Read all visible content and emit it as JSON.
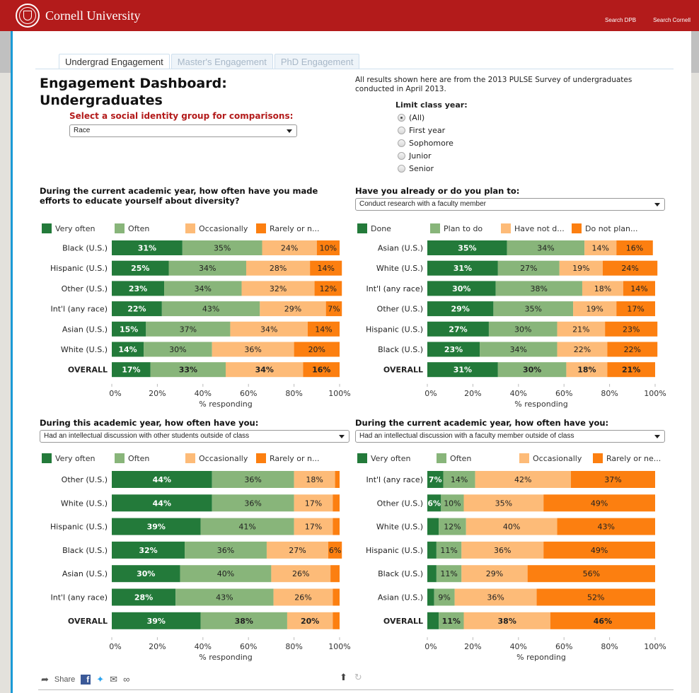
{
  "header": {
    "brand": "Cornell University",
    "links": [
      "Search DPB",
      "Search Cornell"
    ]
  },
  "tabs": [
    {
      "label": "Undergrad Engagement",
      "active": true
    },
    {
      "label": "Master's Engagement",
      "active": false
    },
    {
      "label": "PhD Engagement",
      "active": false
    }
  ],
  "page": {
    "title_line1": "Engagement Dashboard:",
    "title_line2": "Undergraduates",
    "intro": "All results shown here are from the 2013 PULSE Survey of undergraduates conducted in April 2013."
  },
  "group_select": {
    "label": "Select a social identity group for comparisons:",
    "value": "Race"
  },
  "class_year": {
    "label": "Limit class year:",
    "options": [
      "(All)",
      "First year",
      "Sophomore",
      "Junior",
      "Senior"
    ],
    "selected": "(All)"
  },
  "colors": {
    "dark_green": "#237a3a",
    "light_green": "#88b57a",
    "light_orange": "#fdbb78",
    "orange": "#fc7f10"
  },
  "chart_data": [
    {
      "type": "bar",
      "stacked": true,
      "orientation": "horizontal",
      "title": "During the current academic year, how often have you made efforts to educate yourself about diversity?",
      "dropdown": null,
      "legend": [
        "Very often",
        "Often",
        "Occasionally",
        "Rarely or n..."
      ],
      "categories": [
        "Black (U.S.)",
        "Hispanic (U.S.)",
        "Other (U.S.)",
        "Int'l (any race)",
        "Asian (U.S.)",
        "White (U.S.)",
        "OVERALL"
      ],
      "series": [
        {
          "name": "Very often",
          "values": [
            31,
            25,
            23,
            22,
            15,
            14,
            17
          ]
        },
        {
          "name": "Often",
          "values": [
            35,
            34,
            34,
            43,
            37,
            30,
            33
          ]
        },
        {
          "name": "Occasionally",
          "values": [
            24,
            28,
            32,
            29,
            34,
            36,
            34
          ]
        },
        {
          "name": "Rarely or never",
          "values": [
            10,
            14,
            12,
            7,
            14,
            20,
            16
          ]
        }
      ],
      "xlabel": "% responding",
      "xticks": [
        "0%",
        "20%",
        "40%",
        "60%",
        "80%",
        "100%"
      ],
      "xlim": [
        0,
        100
      ]
    },
    {
      "type": "bar",
      "stacked": true,
      "orientation": "horizontal",
      "title": "Have you already or do you plan to:",
      "dropdown": "Conduct research with a faculty member",
      "legend": [
        "Done",
        "Plan to do",
        "Have not d...",
        "Do not plan..."
      ],
      "categories": [
        "Asian (U.S.)",
        "White (U.S.)",
        "Int'l (any race)",
        "Other (U.S.)",
        "Hispanic (U.S.)",
        "Black (U.S.)",
        "OVERALL"
      ],
      "series": [
        {
          "name": "Done",
          "values": [
            35,
            31,
            30,
            29,
            27,
            23,
            31
          ]
        },
        {
          "name": "Plan to do",
          "values": [
            34,
            27,
            38,
            35,
            30,
            34,
            30
          ]
        },
        {
          "name": "Have not decided",
          "values": [
            14,
            19,
            18,
            19,
            21,
            22,
            18
          ]
        },
        {
          "name": "Do not plan to do",
          "values": [
            16,
            24,
            14,
            17,
            23,
            22,
            21
          ]
        }
      ],
      "xlabel": "% responding",
      "xticks": [
        "0%",
        "20%",
        "40%",
        "60%",
        "80%",
        "100%"
      ],
      "xlim": [
        0,
        100
      ]
    },
    {
      "type": "bar",
      "stacked": true,
      "orientation": "horizontal",
      "title": "During this academic year, how often have you:",
      "dropdown": "Had an intellectual discussion with other students outside of class",
      "legend": [
        "Very often",
        "Often",
        "Occasionally",
        "Rarely or n..."
      ],
      "categories": [
        "Other (U.S.)",
        "White (U.S.)",
        "Hispanic (U.S.)",
        "Black (U.S.)",
        "Asian (U.S.)",
        "Int'l (any race)",
        "OVERALL"
      ],
      "series": [
        {
          "name": "Very often",
          "values": [
            44,
            44,
            39,
            32,
            30,
            28,
            39
          ]
        },
        {
          "name": "Often",
          "values": [
            36,
            36,
            41,
            36,
            40,
            43,
            38
          ]
        },
        {
          "name": "Occasionally",
          "values": [
            18,
            17,
            17,
            27,
            26,
            26,
            20
          ]
        },
        {
          "name": "Rarely or never",
          "values": [
            2,
            3,
            3,
            6,
            4,
            3,
            3
          ]
        }
      ],
      "hidden_label_below": 5,
      "xlabel": "% responding",
      "xticks": [
        "0%",
        "20%",
        "40%",
        "60%",
        "80%",
        "100%"
      ],
      "xlim": [
        0,
        100
      ]
    },
    {
      "type": "bar",
      "stacked": true,
      "orientation": "horizontal",
      "title": "During the current academic year, how often have you:",
      "dropdown": "Had an intellectual discussion with a faculty member outside of class",
      "legend": [
        "Very often",
        "Often",
        "Occasionally",
        "Rarely or ne..."
      ],
      "categories": [
        "Int'l (any race)",
        "Other (U.S.)",
        "White (U.S.)",
        "Hispanic (U.S.)",
        "Black (U.S.)",
        "Asian (U.S.)",
        "OVERALL"
      ],
      "series": [
        {
          "name": "Very often",
          "values": [
            7,
            6,
            5,
            4,
            4,
            3,
            5
          ]
        },
        {
          "name": "Often",
          "values": [
            14,
            10,
            12,
            11,
            11,
            9,
            11
          ]
        },
        {
          "name": "Occasionally",
          "values": [
            42,
            35,
            40,
            36,
            29,
            36,
            38
          ]
        },
        {
          "name": "Rarely or never",
          "values": [
            37,
            49,
            43,
            49,
            56,
            52,
            46
          ]
        }
      ],
      "hidden_label_below": 6,
      "xlabel": "% reponding",
      "xticks": [
        "0%",
        "20%",
        "40%",
        "60%",
        "80%",
        "100%"
      ],
      "xlim": [
        0,
        100
      ]
    }
  ],
  "footer": {
    "share_label": "Share",
    "icons": [
      "share-arrow-icon",
      "facebook-icon",
      "twitter-icon",
      "email-icon",
      "link-icon",
      "download-icon",
      "revert-icon"
    ]
  }
}
